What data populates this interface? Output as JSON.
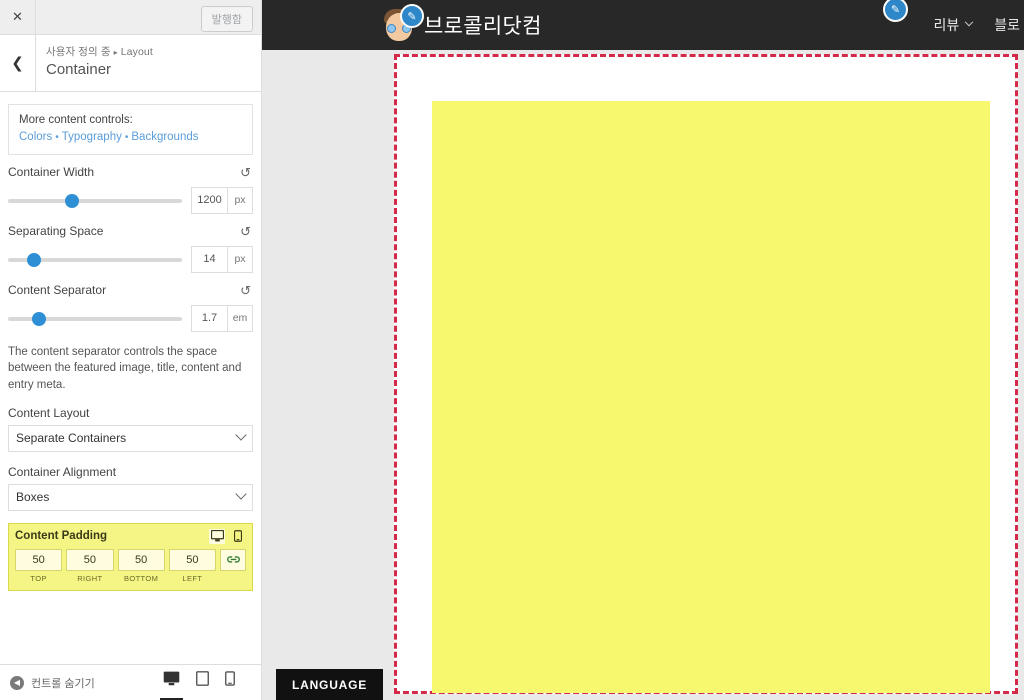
{
  "customizer": {
    "close_icon": "close-icon",
    "publish_button": "발행함",
    "back_icon": "back-chevron-icon",
    "breadcrumb_parent": "사용자 정의 중",
    "breadcrumb_sep": "▸",
    "breadcrumb_current": "Layout",
    "panel_title": "Container",
    "notice": {
      "text": "More content controls:",
      "links": [
        "Colors",
        "Typography",
        "Backgrounds"
      ],
      "separator": "•"
    },
    "controls": [
      {
        "label": "Container Width",
        "value": "1200",
        "unit": "px",
        "handle_pct": "37%",
        "reset_icon": "reset-icon"
      },
      {
        "label": "Separating Space",
        "value": "14",
        "unit": "px",
        "handle_pct": "15%",
        "reset_icon": "reset-icon"
      },
      {
        "label": "Content Separator",
        "value": "1.7",
        "unit": "em",
        "handle_pct": "18%",
        "reset_icon": "reset-icon"
      }
    ],
    "helper_text": "The content separator controls the space between the featured image, title, content and entry meta.",
    "selects": [
      {
        "label": "Content Layout",
        "value": "Separate Containers"
      },
      {
        "label": "Container Alignment",
        "value": "Boxes"
      }
    ],
    "padding_group": {
      "title": "Content Padding",
      "desktop_icon": "desktop-icon",
      "mobile_icon": "mobile-icon",
      "link_icon": "link-icon",
      "fields": [
        {
          "value": "50",
          "caption": "TOP"
        },
        {
          "value": "50",
          "caption": "RIGHT"
        },
        {
          "value": "50",
          "caption": "BOTTOM"
        },
        {
          "value": "50",
          "caption": "LEFT"
        }
      ]
    },
    "footer": {
      "hide_controls_label": "컨트롤 숨기기",
      "collapse_icon": "collapse-icon",
      "devices": [
        {
          "icon": "desktop-icon",
          "active": true
        },
        {
          "icon": "tablet-icon",
          "active": false
        },
        {
          "icon": "mobile-icon",
          "active": false
        }
      ]
    }
  },
  "preview": {
    "site_title": "브로콜리닷컴",
    "avatar_icon": "avatar-icon",
    "brand_edit_badge_icon": "pencil-edit-icon",
    "nav_edit_badge_icon": "pencil-edit-icon",
    "nav_items": [
      {
        "label": "리뷰",
        "has_chevron": true
      },
      {
        "label": "블로",
        "has_chevron": false
      }
    ],
    "language_tab": "LANGUAGE",
    "highlight_border_color": "#d42a49",
    "content_block_color": "#f8f86e",
    "header_bg_color": "#282828"
  }
}
